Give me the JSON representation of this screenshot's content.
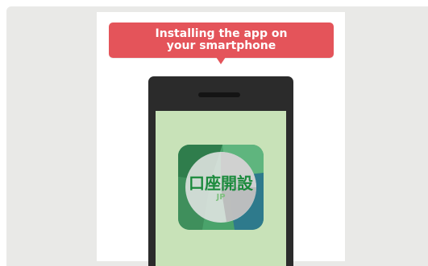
{
  "callout": {
    "line1": "Installing the app on",
    "line2": "your smartphone"
  },
  "app_icon": {
    "label": "口座開設",
    "sub_label": "JP",
    "icon": "bank-account-app-icon"
  },
  "colors": {
    "callout_bg": "#e4545a",
    "outer_bg": "#e9e9e7",
    "phone_body": "#2b2b2b",
    "screen_bg": "#c8e2b8",
    "icon_green_dark": "#2f7d4c",
    "icon_green_mid": "#4aa36b"
  }
}
